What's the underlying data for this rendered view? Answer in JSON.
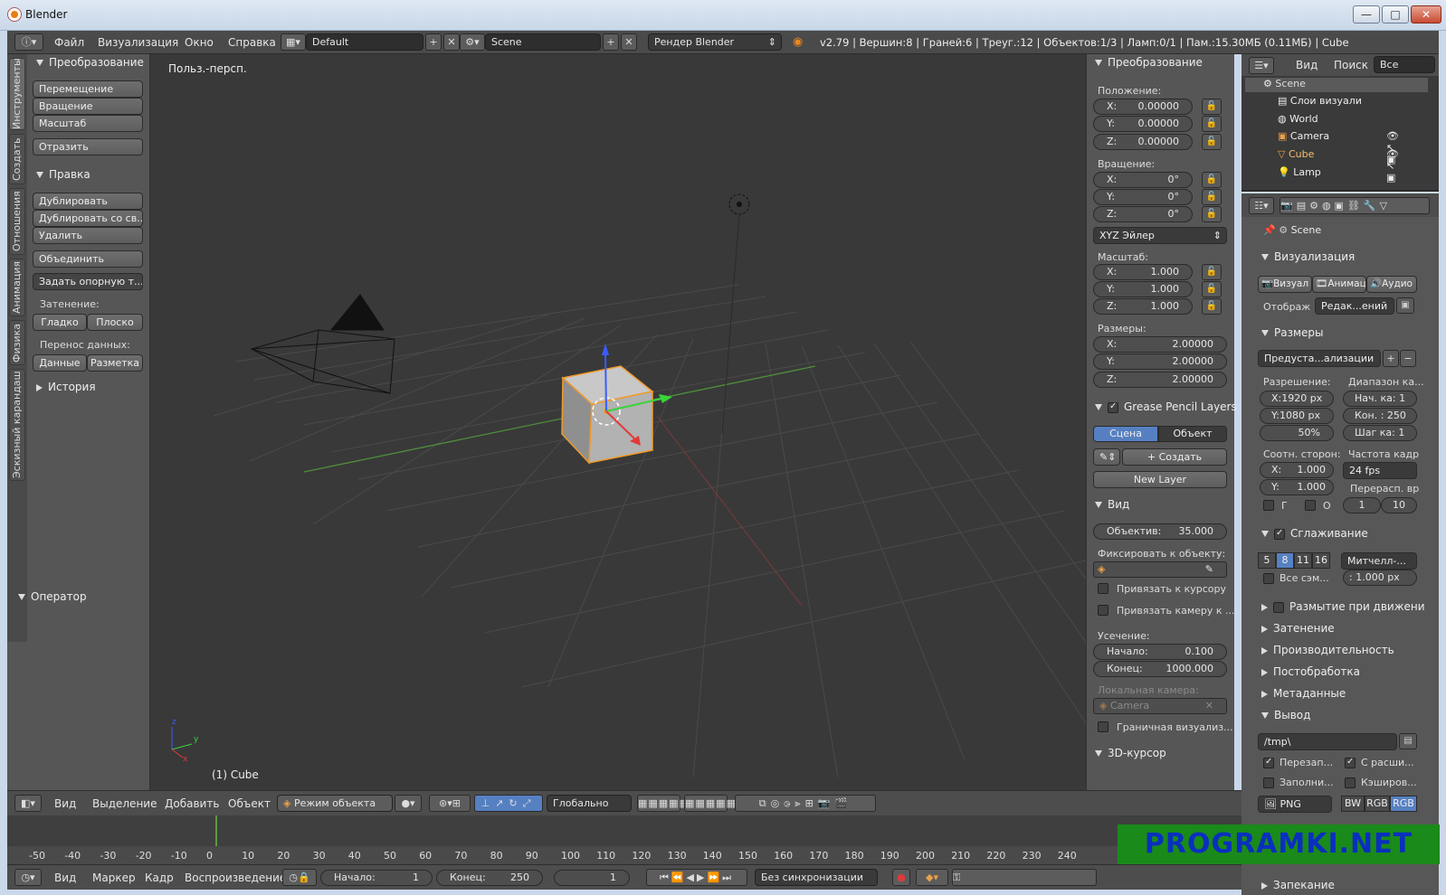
{
  "window": {
    "title": "Blender",
    "min": "—",
    "max": "□",
    "close": "✕"
  },
  "infobar": {
    "menus": [
      "Файл",
      "Визуализация",
      "Окно",
      "Справка"
    ],
    "layout": "Default",
    "scene": "Scene",
    "engine": "Рендер Blender",
    "stats": "v2.79 | Вершин:8 | Граней:6 | Треуг.:12 | Объектов:1/3 | Ламп:0/1 | Пам.:15.30МБ (0.11МБ) | Cube"
  },
  "toolshelf": {
    "tabs": [
      "Инструменты",
      "Создать",
      "Отношения",
      "Анимация",
      "Физика",
      "Эскизный карандаш"
    ],
    "transform": {
      "title": "Преобразование",
      "buttons": [
        "Перемещение",
        "Вращение",
        "Масштаб",
        "Отразить"
      ]
    },
    "edit": {
      "title": "Правка",
      "buttons": [
        "Дублировать",
        "Дублировать со св...",
        "Удалить",
        "Объединить",
        "Задать опорную т..."
      ]
    },
    "shading": {
      "label": "Затенение:",
      "smooth": "Гладко",
      "flat": "Плоско"
    },
    "transfer": {
      "label": "Перенос данных:",
      "data": "Данные",
      "layout": "Разметка"
    },
    "history": "История",
    "operator": "Оператор"
  },
  "viewport": {
    "label": "Польз.-персп.",
    "object": "(1) Cube",
    "axis_x": "x",
    "axis_y": "y",
    "axis_z": "z"
  },
  "npanel": {
    "transform_title": "Преобразование",
    "location_label": "Положение:",
    "location": [
      {
        "k": "X:",
        "v": "0.00000"
      },
      {
        "k": "Y:",
        "v": "0.00000"
      },
      {
        "k": "Z:",
        "v": "0.00000"
      }
    ],
    "rotation_label": "Вращение:",
    "rotation": [
      {
        "k": "X:",
        "v": "0°"
      },
      {
        "k": "Y:",
        "v": "0°"
      },
      {
        "k": "Z:",
        "v": "0°"
      }
    ],
    "rotation_mode": "XYZ Эйлер",
    "scale_label": "Масштаб:",
    "scale": [
      {
        "k": "X:",
        "v": "1.000"
      },
      {
        "k": "Y:",
        "v": "1.000"
      },
      {
        "k": "Z:",
        "v": "1.000"
      }
    ],
    "dims_label": "Размеры:",
    "dims": [
      {
        "k": "X:",
        "v": "2.00000"
      },
      {
        "k": "Y:",
        "v": "2.00000"
      },
      {
        "k": "Z:",
        "v": "2.00000"
      }
    ],
    "gp_title": "Grease Pencil Layers",
    "gp_scene": "Сцена",
    "gp_object": "Объект",
    "gp_create": "Создать",
    "gp_newlayer": "New Layer",
    "view_title": "Вид",
    "lens_k": "Объектив:",
    "lens_v": "35.000",
    "lock_label": "Фиксировать к объекту:",
    "lock_cursor": "Привязать к курсору",
    "lock_camera": "Привязать камеру к ...",
    "clip_label": "Усечение:",
    "clip_start_k": "Начало:",
    "clip_start_v": "0.100",
    "clip_end_k": "Конец:",
    "clip_end_v": "1000.000",
    "local_cam": "Локальная камера:",
    "camera": "Camera",
    "render_border": "Граничная визуализ...",
    "cursor_title": "3D-курсор"
  },
  "outliner": {
    "view": "Вид",
    "search": "Поиск",
    "filter": "Все сцены",
    "items": [
      "Scene",
      "Слои визуали",
      "World",
      "Camera",
      "Cube",
      "Lamp"
    ]
  },
  "props": {
    "scene": "Scene",
    "render_title": "Визуализация",
    "render_btn": "Визуал",
    "anim_btn": "Анимац",
    "audio_btn": "Аудио",
    "display_k": "Отображ",
    "display_v": "Редак...ений",
    "dims_title": "Размеры",
    "preset": "Предуста...ализации",
    "res_label": "Разрешение:",
    "range_label": "Диапазон ка...",
    "res_x": "X:1920 px",
    "res_y": "Y:1080 px",
    "res_pct": "50%",
    "start": "Нач. ка: 1",
    "end": "Кон. : 250",
    "step": "Шаг ка: 1",
    "aspect_label": "Соотн. сторон:",
    "fps_label": "Частота кадр",
    "aspect_x_k": "X:",
    "aspect_x_v": "1.000",
    "aspect_y_k": "Y:",
    "aspect_y_v": "1.000",
    "fps": "24 fps",
    "remap_label": "Перерасп. вр",
    "remap_old": "1",
    "remap_new": "10",
    "border": "Г",
    "crop": "О",
    "aa_title": "Сглаживание",
    "aa_samples": [
      "5",
      "8",
      "11",
      "16"
    ],
    "aa_filter": "Митчелл-...",
    "full_sample": "Все сэм...",
    "filter_size": ": 1.000 px",
    "motion_blur": "Размытие при движени",
    "shading": "Затенение",
    "performance": "Производительность",
    "postprocess": "Постобработка",
    "metadata": "Метаданные",
    "output_title": "Вывод",
    "output_path": "/tmp\\",
    "overwrite": "Перезап...",
    "ext": "С расши...",
    "placeholders": "Заполни...",
    "cache": "Кэширов...",
    "format": "PNG",
    "bw": "BW",
    "rgb": "RGB",
    "rgba": "RGB",
    "bake": "Запекание"
  },
  "vpheader": {
    "view": "Вид",
    "select": "Выделение",
    "add": "Добавить",
    "object": "Объект",
    "mode": "Режим объекта",
    "orientation": "Глобально"
  },
  "timeline": {
    "ticks": [
      "-50",
      "-40",
      "-30",
      "-20",
      "-10",
      "0",
      "10",
      "20",
      "30",
      "40",
      "50",
      "60",
      "70",
      "80",
      "90",
      "100",
      "110",
      "120",
      "130",
      "140",
      "150",
      "160",
      "170",
      "180",
      "190",
      "200",
      "210",
      "220",
      "230",
      "240"
    ],
    "view": "Вид",
    "marker": "Маркер",
    "frame": "Кадр",
    "playback": "Воспроизведение",
    "start_k": "Начало:",
    "start_v": "1",
    "end_k": "Конец:",
    "end_v": "250",
    "current": "1",
    "sync": "Без синхронизации"
  },
  "watermark": "PROGRAMKI.NET"
}
